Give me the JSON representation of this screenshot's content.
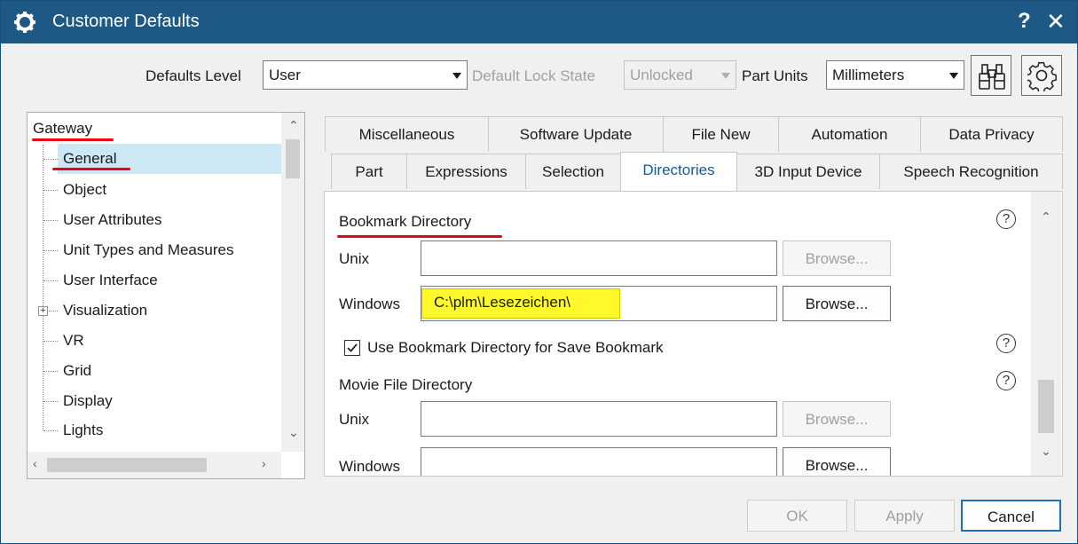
{
  "window": {
    "title": "Customer Defaults",
    "help": "?",
    "close": "✕"
  },
  "toolbar": {
    "defaults_level_label": "Defaults Level",
    "defaults_level_value": "User",
    "lock_state_label": "Default Lock State",
    "lock_state_value": "Unlocked",
    "part_units_label": "Part Units",
    "part_units_value": "Millimeters",
    "find_icon": "binoculars-icon",
    "settings_icon": "gear-icon"
  },
  "tree": {
    "root": "Gateway",
    "items": [
      "General",
      "Object",
      "User Attributes",
      "Unit Types and Measures",
      "User Interface",
      "Visualization",
      "VR",
      "Grid",
      "Display",
      "Lights"
    ],
    "expander": "+"
  },
  "tabs": {
    "row1": [
      "Miscellaneous",
      "Software Update",
      "File New",
      "Automation",
      "Data Privacy"
    ],
    "row2": [
      "Part",
      "Expressions",
      "Selection",
      "Directories",
      "3D Input Device",
      "Speech Recognition"
    ],
    "active": "Directories"
  },
  "content": {
    "bookmark_heading": "Bookmark Directory",
    "unix_label": "Unix",
    "unix_value": "",
    "windows_label": "Windows",
    "windows_value": "C:\\plm\\Lesezeichen\\",
    "browse_label": "Browse...",
    "checkbox_label": "Use Bookmark Directory for Save Bookmark",
    "checkbox_checked": true,
    "movie_heading": "Movie File Directory",
    "movie_unix_label": "Unix",
    "movie_windows_label": "Windows",
    "help_symbol": "?"
  },
  "buttons": {
    "ok": "OK",
    "apply": "Apply",
    "cancel": "Cancel"
  },
  "colors": {
    "titlebar": "#1e5985",
    "selection": "#cce8f4",
    "highlight": "#fff82a",
    "annotation": "#e30613",
    "active_tab_text": "#1a5a94"
  }
}
